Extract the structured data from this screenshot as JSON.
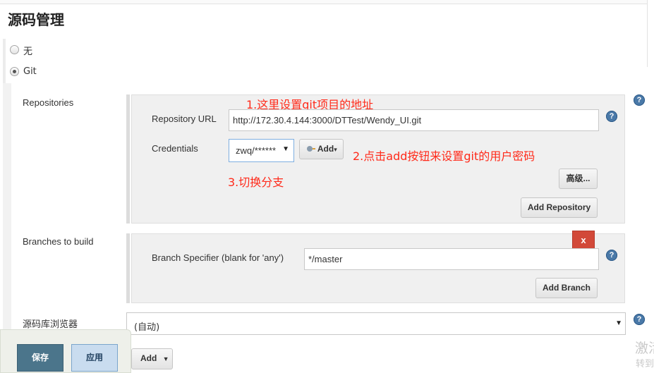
{
  "section": {
    "title": "源码管理"
  },
  "scm_options": [
    {
      "label": "无",
      "selected": false
    },
    {
      "label": "Git",
      "selected": true
    }
  ],
  "repositories": {
    "label": "Repositories",
    "url_label": "Repository URL",
    "url_value": "http://172.30.4.144:3000/DTTest/Wendy_UI.git",
    "credentials_label": "Credentials",
    "credentials_value": "zwq/******",
    "add_button": "Add",
    "advanced_button": "高级...",
    "add_repository_button": "Add Repository"
  },
  "annotations": {
    "note1": "1.这里设置git项目的地址",
    "note2": "2.点击add按钮来设置git的用户密码",
    "note3": "3.切换分支"
  },
  "branches": {
    "label": "Branches to build",
    "delete_button": "x",
    "specifier_label": "Branch Specifier (blank for 'any')",
    "specifier_value": "*/master",
    "add_branch_button": "Add Branch"
  },
  "repo_browser": {
    "label": "源码库浏览器",
    "selected": "(自动)"
  },
  "additional": {
    "add_button": "Add"
  },
  "footer": {
    "save_button": "保存",
    "apply_button": "应用"
  },
  "help_icon_text": "?",
  "watermark": {
    "line1": "激活",
    "line2": "转到"
  },
  "colors": {
    "annotation": "#ff2a1a",
    "delete": "#d24939",
    "help": "#4a79a8",
    "save": "#4b758b",
    "apply": "#c9dcef"
  }
}
